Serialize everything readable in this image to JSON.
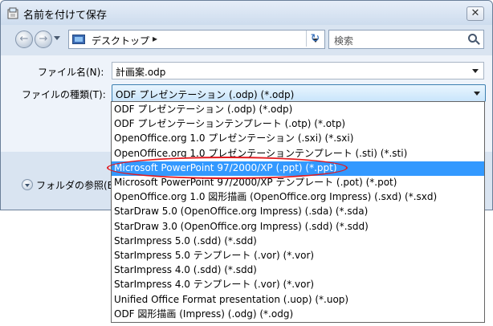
{
  "window": {
    "title": "名前を付けて保存",
    "close_label": "✕"
  },
  "nav": {
    "back_label": "←",
    "forward_label": "→",
    "address": "デスクトップ",
    "address_arrow": "▸",
    "refresh_label": "↻",
    "search_placeholder": "検索"
  },
  "form": {
    "filename_label": "ファイル名(N):",
    "filename_value": "計画案.odp",
    "filetype_label": "ファイルの種類(T):",
    "filetype_value": "ODF プレゼンテーション (.odp) (*.odp)"
  },
  "folder_toggle_label": "フォルダの参照(B)",
  "dropdown": {
    "items": [
      "ODF プレゼンテーション (.odp) (*.odp)",
      "ODF プレゼンテーションテンプレート (.otp) (*.otp)",
      "OpenOffice.org 1.0 プレゼンテーション (.sxi) (*.sxi)",
      "OpenOffice.org 1.0 プレゼンテーションテンプレート (.sti) (*.sti)",
      "Microsoft PowerPoint 97/2000/XP (.ppt) (*.ppt)",
      "Microsoft PowerPoint 97/2000/XP テンプレート (.pot) (*.pot)",
      "OpenOffice.org 1.0 図形描画 (OpenOffice.org Impress) (.sxd) (*.sxd)",
      "StarDraw 5.0 (OpenOffice.org Impress) (.sda) (*.sda)",
      "StarDraw 3.0 (OpenOffice.org Impress) (.sdd) (*.sdd)",
      "StarImpress 5.0 (.sdd) (*.sdd)",
      "StarImpress 5.0 テンプレート (.vor) (*.vor)",
      "StarImpress 4.0 (.sdd) (*.sdd)",
      "StarImpress 4.0 テンプレート (.vor) (*.vor)",
      "Unified Office Format presentation (.uop) (*.uop)",
      "ODF 図形描画 (Impress) (.odg) (*.odg)"
    ],
    "selected_index": 4
  },
  "colors": {
    "selection": "#3399ff",
    "annotation": "#e0191f"
  },
  "icons": {
    "title": "save-dialog-icon",
    "address": "desktop-icon",
    "search": "search-icon"
  }
}
